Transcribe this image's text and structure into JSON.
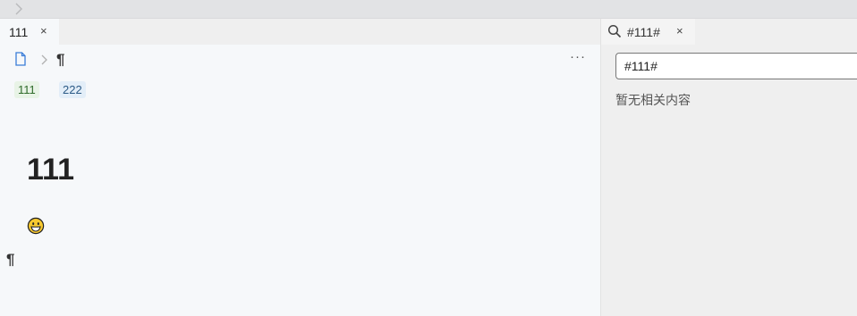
{
  "topbar": {
    "icon": "chevron-right-icon"
  },
  "editor": {
    "tab": {
      "label": "111",
      "close": "×"
    },
    "breadcrumb": {
      "doc_icon": "file-icon",
      "separator_icon": "chevron-right-icon",
      "block": "¶"
    },
    "more": "···",
    "tags": [
      "111",
      "222"
    ],
    "heading": "111",
    "emoji_icon": "grinning-face-icon",
    "paragraph_marker": "¶"
  },
  "search": {
    "tab": {
      "icon": "search-icon",
      "label": "#111#",
      "close": "×"
    },
    "query": "#111#",
    "empty_message": "暂无相关内容"
  }
}
